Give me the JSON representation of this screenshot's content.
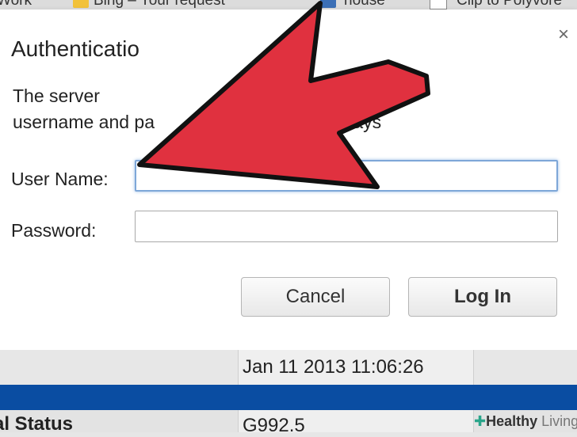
{
  "bookmarks": [
    {
      "label": "Work"
    },
    {
      "label": "Bing – Your request"
    },
    {
      "label": "house"
    },
    {
      "label": "Clip to Polyvore"
    }
  ],
  "dialog": {
    "title": "Authenticatio",
    "close_glyph": "×",
    "message_line1": "The server",
    "message_line2": "username and pa",
    "message_line2_tail": "Says",
    "username_label": "User Name:",
    "password_label": "Password:",
    "username_value": "",
    "password_value": "",
    "cancel_label": "Cancel",
    "login_label": "Log In"
  },
  "page": {
    "date_value": "Jan 11 2013 11:06:26",
    "status_label": "al Status",
    "status_value": "G992.5"
  },
  "watermark": {
    "cross": "✚",
    "brand_bold": "Healthy",
    "brand_light": "Living"
  },
  "colors": {
    "arrow_fill": "#e0313f",
    "band_blue": "#0a4da2",
    "focus_ring": "#7ea7d8"
  }
}
